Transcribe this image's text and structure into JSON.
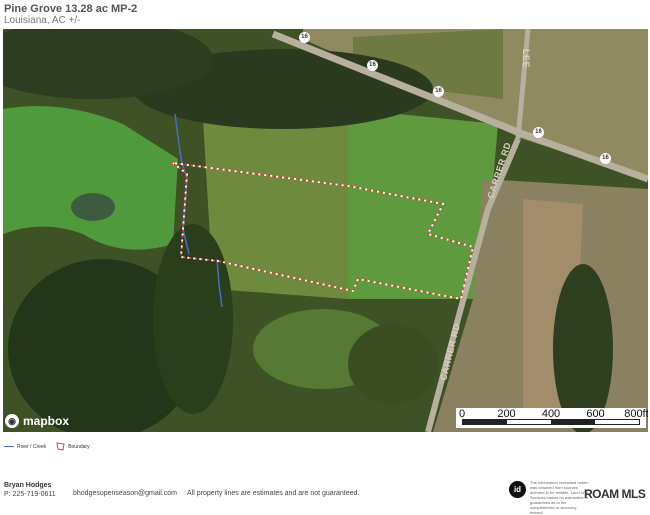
{
  "header": {
    "title": "Pine Grove 13.28 ac MP-2",
    "subtitle": "Louisiana,  AC +/-"
  },
  "map": {
    "road_labels": [
      "CARRER RD",
      "CARRER RD",
      "LEE"
    ],
    "highway_shields": [
      "16",
      "16",
      "16",
      "16",
      "16"
    ],
    "attribution": "mapbox",
    "scale": {
      "ticks": [
        "0",
        "200",
        "400",
        "600",
        "800ft"
      ]
    },
    "colors": {
      "boundary": "#e23b3b",
      "creek": "#4a6cc8",
      "field": "#5f8a3a",
      "forest": "#2b3f1d",
      "road": "#b7b09e"
    }
  },
  "legend": {
    "items": [
      {
        "label": "River / Creek",
        "icon": "creek-line-icon"
      },
      {
        "label": "Boundary",
        "icon": "boundary-polygon-icon"
      }
    ]
  },
  "footer": {
    "agent_name": "Bryan Hodges",
    "phone": "P: 225-719-0611",
    "email": "bhodgesopenseason@gmail.com",
    "disclaimer": "All property lines are estimates and are not guaranteed.",
    "fine_print": "The information contained herein was obtained from sources deemed to be reliable. Land id™ Services makes no warranties or guarantees as to the completeness or accuracy thereof.",
    "brand": "ROAM MLS",
    "id_logo": "id"
  }
}
